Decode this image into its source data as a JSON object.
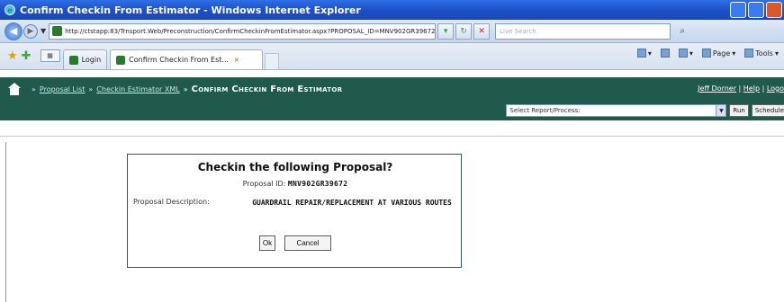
{
  "window": {
    "title": "Confirm Checkin From Estimator - Windows Internet Explorer"
  },
  "address": {
    "url": "http://ctstapp:83/Trnsport.Web/Preconstruction/ConfirmCheckinFromEstimator.aspx?PROPOSAL_ID=MNV902GR39672&DE",
    "search_placeholder": "Live Search"
  },
  "tabs": [
    {
      "label": "Login"
    },
    {
      "label": "Confirm Checkin From Est..."
    }
  ],
  "toolbar": {
    "page_label": "Page",
    "tools_label": "Tools"
  },
  "breadcrumb": {
    "items": [
      "Proposal List",
      "Checkin Estimator XML"
    ],
    "current": "Confirm Checkin From Estimator"
  },
  "user": {
    "name": "Jeff Dorner",
    "help": "Help",
    "logout": "Logo"
  },
  "report": {
    "select_value": "Select Report/Process:",
    "run_label": "Run",
    "schedule_label": "Schedule"
  },
  "dialog": {
    "title": "Checkin the following Proposal?",
    "proposal_id_label": "Proposal ID:",
    "proposal_id": "MNV902GR39672",
    "description_label": "Proposal Description:",
    "description": "GUARDRAIL REPAIR/REPLACEMENT AT VARIOUS ROUTES",
    "ok_label": "Ok",
    "cancel_label": "Cancel"
  },
  "colors": {
    "app_bar": "#1f5a4d",
    "title_bar": "#1d4fc9"
  }
}
